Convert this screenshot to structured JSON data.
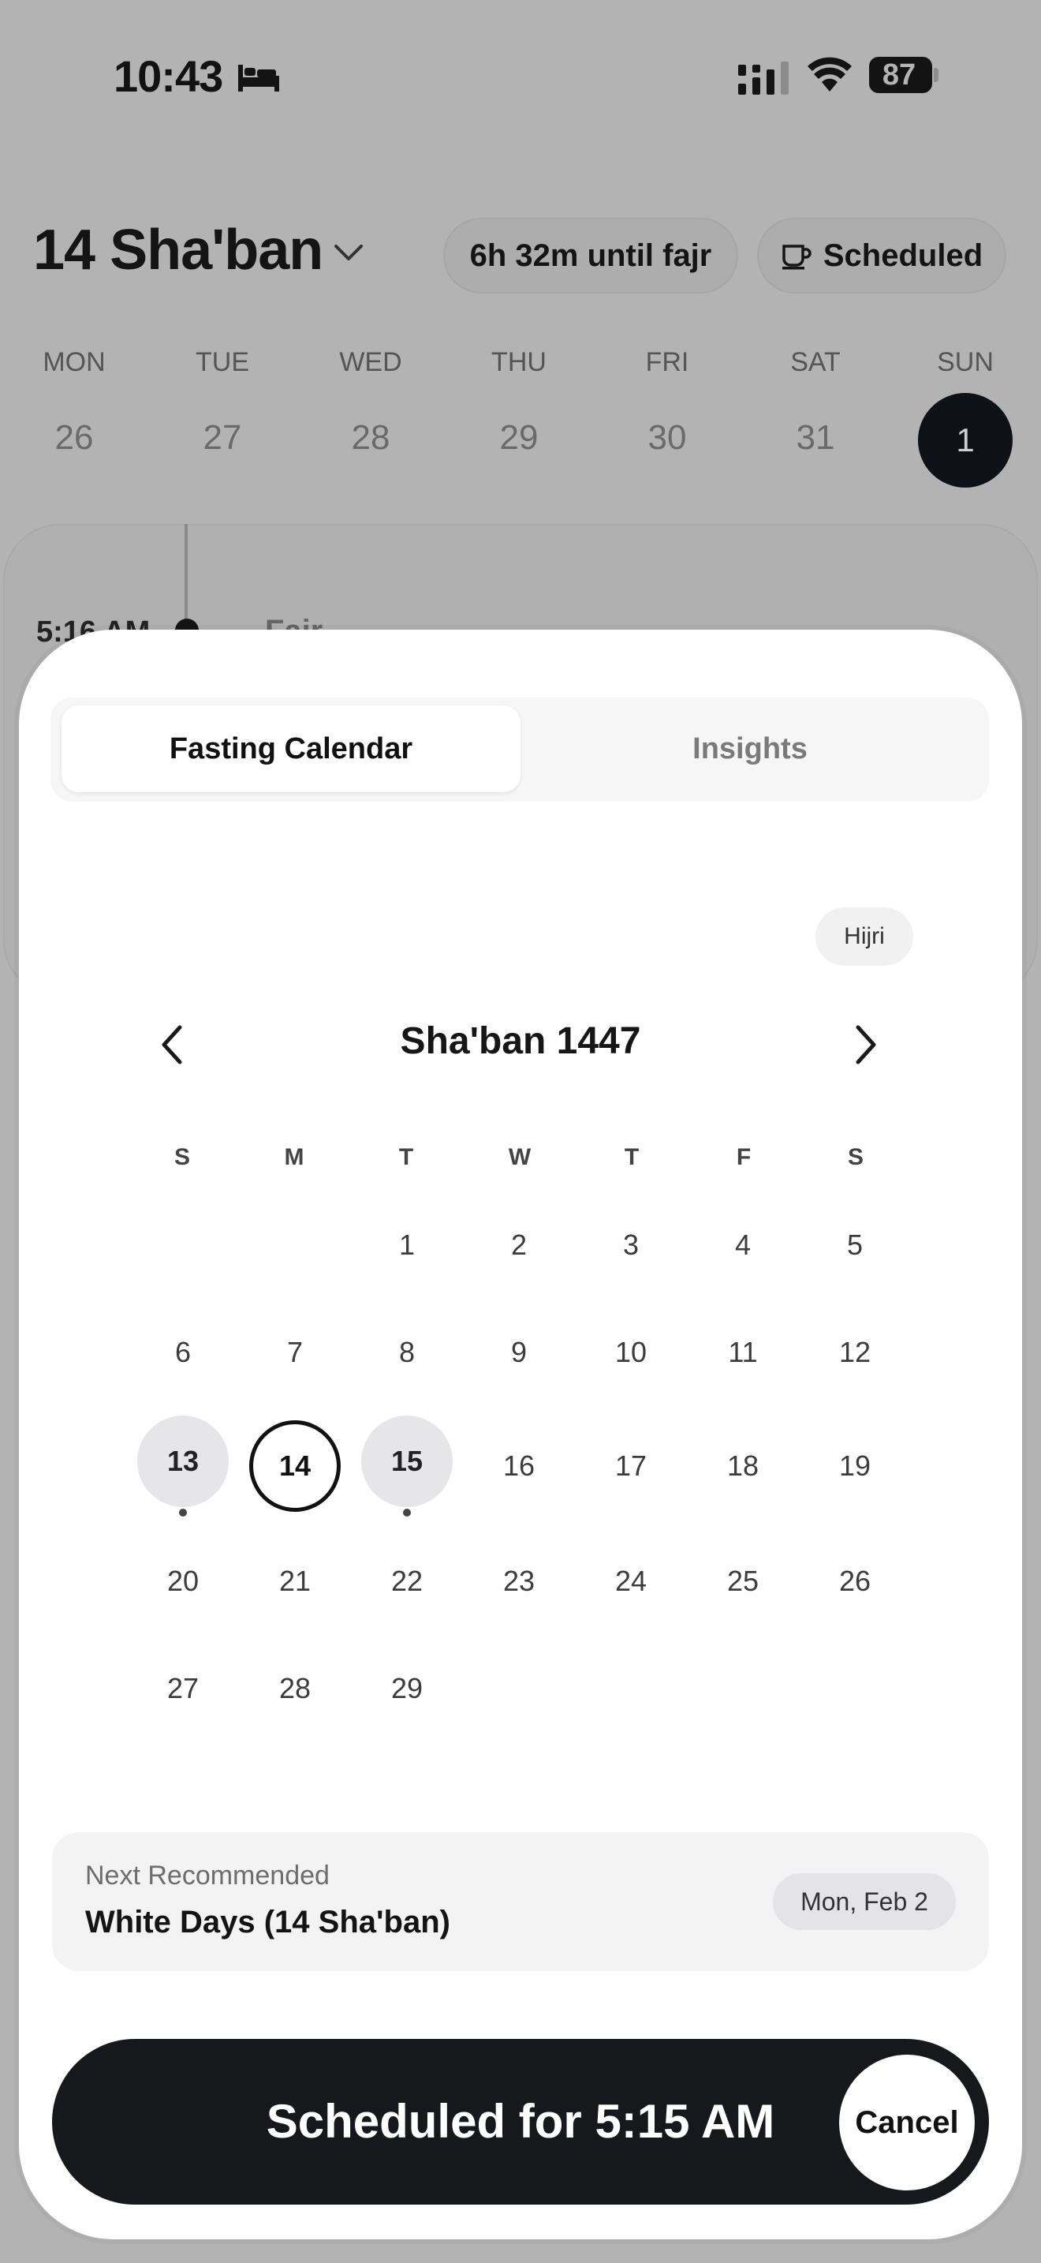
{
  "status_bar": {
    "time": "10:43",
    "battery": "87",
    "icons": [
      "bed-icon",
      "signal-icon",
      "wifi-icon",
      "battery-icon"
    ]
  },
  "header": {
    "date_title": "14 Sha'ban",
    "countdown": "6h 32m until fajr",
    "scheduled": "Scheduled"
  },
  "week": {
    "days": [
      {
        "label": "MON",
        "num": "26"
      },
      {
        "label": "TUE",
        "num": "27"
      },
      {
        "label": "WED",
        "num": "28"
      },
      {
        "label": "THU",
        "num": "29"
      },
      {
        "label": "FRI",
        "num": "30"
      },
      {
        "label": "SAT",
        "num": "31"
      },
      {
        "label": "SUN",
        "num": "1"
      }
    ],
    "selected": "1"
  },
  "timeline": {
    "time": "5:16 AM",
    "label": "Fajr"
  },
  "sheet": {
    "tabs": {
      "active": "Fasting Calendar",
      "inactive": "Insights"
    },
    "calendar_mode": "Hijri",
    "month_title": "Sha'ban 1447",
    "dow": [
      "S",
      "M",
      "T",
      "W",
      "T",
      "F",
      "S"
    ],
    "days": [
      [
        "",
        "",
        "1",
        "2",
        "3",
        "4",
        "5"
      ],
      [
        "6",
        "7",
        "8",
        "9",
        "10",
        "11",
        "12"
      ],
      [
        "13",
        "14",
        "15",
        "16",
        "17",
        "18",
        "19"
      ],
      [
        "20",
        "21",
        "22",
        "23",
        "24",
        "25",
        "26"
      ],
      [
        "27",
        "28",
        "29",
        "",
        "",
        "",
        ""
      ]
    ],
    "fast_days": [
      "13",
      "15"
    ],
    "today": "14",
    "next": {
      "label": "Next Recommended",
      "title": "White Days (14 Sha'ban)",
      "date": "Mon, Feb 2"
    },
    "cta": "Scheduled for 5:15 AM",
    "cancel": "Cancel"
  },
  "colors": {
    "overlay_bg": "#b3b3b3",
    "sheet_bg": "#ffffff",
    "cta_bg": "#17181b",
    "fast_day_bg": "#e6e6e8"
  }
}
